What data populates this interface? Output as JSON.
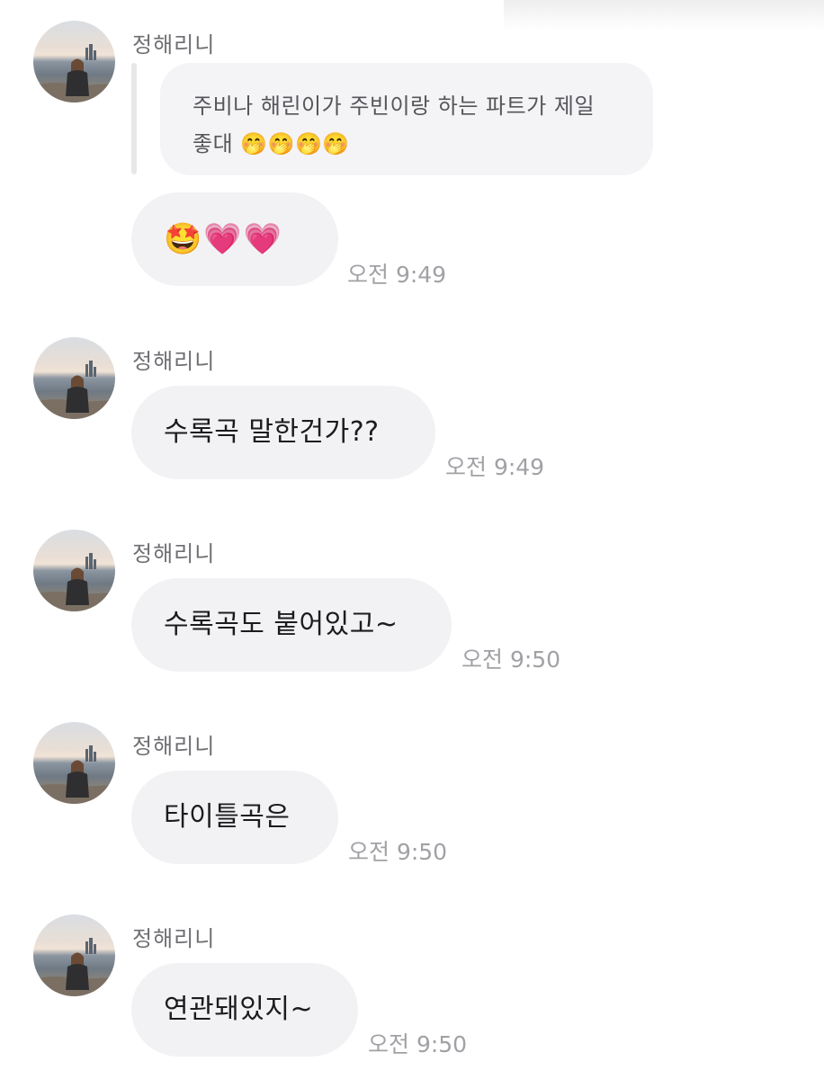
{
  "chat": {
    "messages": [
      {
        "sender": "정해리니",
        "reply_quote": "주비나 해린이가 주빈이랑 하는 파트가 제일 좋대 🤭🤭🤭🤭",
        "text": "🤩💗💗",
        "time": "오전 9:49"
      },
      {
        "sender": "정해리니",
        "text": "수록곡 말한건가??",
        "time": "오전 9:49"
      },
      {
        "sender": "정해리니",
        "text": "수록곡도 붙어있고~",
        "time": "오전 9:50"
      },
      {
        "sender": "정해리니",
        "text": "타이틀곡은",
        "time": "오전 9:50"
      },
      {
        "sender": "정해리니",
        "text": "연관돼있지~",
        "time": "오전 9:50"
      }
    ]
  }
}
